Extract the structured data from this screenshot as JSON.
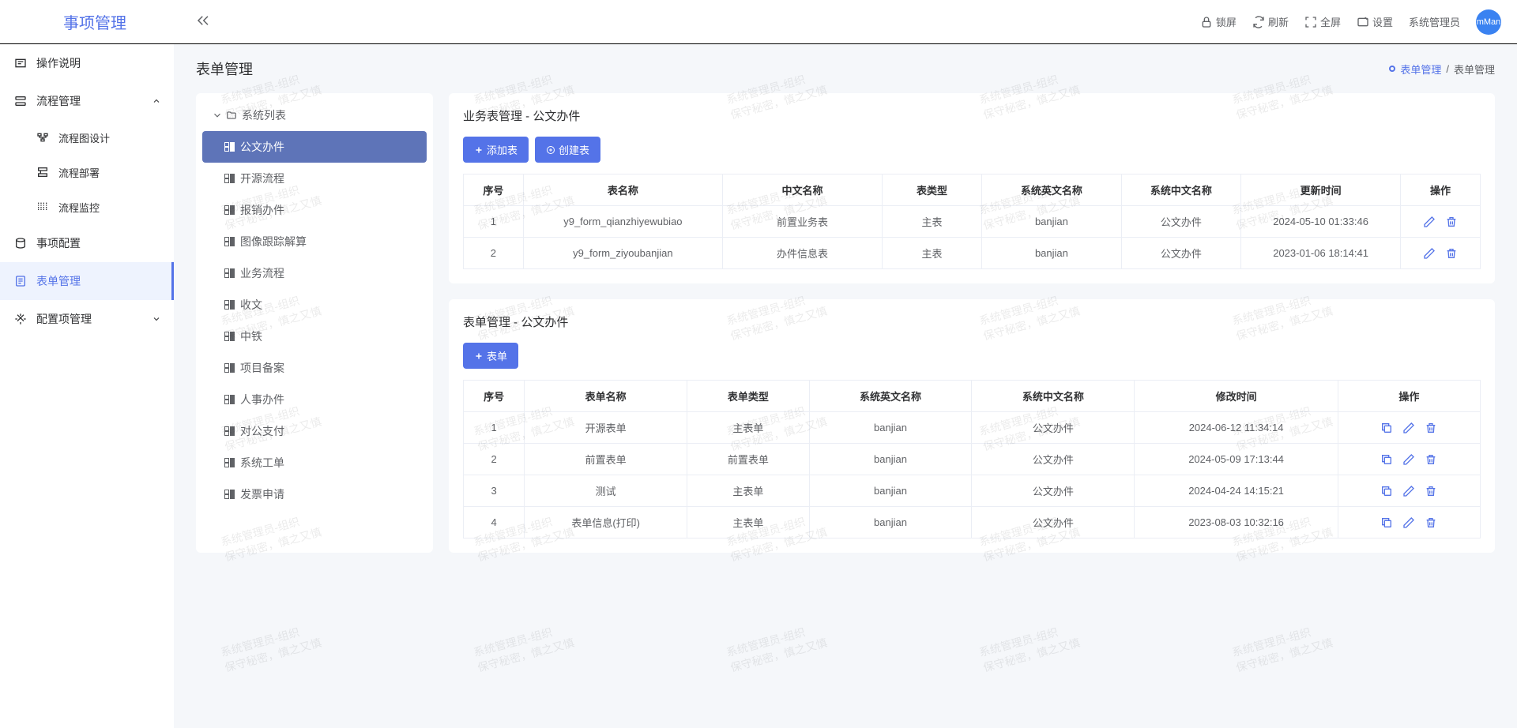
{
  "app_title": "事项管理",
  "header": {
    "lock": "锁屏",
    "refresh": "刷新",
    "fullscreen": "全屏",
    "settings": "设置",
    "username": "系统管理员",
    "avatar_text": "mMan"
  },
  "sidebar": [
    {
      "label": "操作说明",
      "icon": "help",
      "expandable": false,
      "children": []
    },
    {
      "label": "流程管理",
      "icon": "flow",
      "expandable": true,
      "expanded": true,
      "children": [
        {
          "label": "流程图设计",
          "icon": "design"
        },
        {
          "label": "流程部署",
          "icon": "deploy"
        },
        {
          "label": "流程监控",
          "icon": "monitor"
        }
      ]
    },
    {
      "label": "事项配置",
      "icon": "config",
      "expandable": false,
      "children": []
    },
    {
      "label": "表单管理",
      "icon": "form",
      "expandable": false,
      "active": true,
      "children": []
    },
    {
      "label": "配置项管理",
      "icon": "settings",
      "expandable": true,
      "expanded": false,
      "children": []
    }
  ],
  "page": {
    "title": "表单管理",
    "breadcrumb": [
      "表单管理",
      "表单管理"
    ]
  },
  "tree": {
    "root": "系统列表",
    "items": [
      {
        "label": "公文办件",
        "active": true
      },
      {
        "label": "开源流程"
      },
      {
        "label": "报销办件"
      },
      {
        "label": "图像跟踪解算"
      },
      {
        "label": "业务流程"
      },
      {
        "label": "收文"
      },
      {
        "label": "中铁"
      },
      {
        "label": "项目备案"
      },
      {
        "label": "人事办件"
      },
      {
        "label": "对公支付"
      },
      {
        "label": "系统工单"
      },
      {
        "label": "发票申请"
      }
    ]
  },
  "biz_table": {
    "title": "业务表管理 - 公文办件",
    "btn_add": "添加表",
    "btn_create": "创建表",
    "columns": [
      "序号",
      "表名称",
      "中文名称",
      "表类型",
      "系统英文名称",
      "系统中文名称",
      "更新时间",
      "操作"
    ],
    "rows": [
      {
        "idx": "1",
        "name": "y9_form_qianzhiyewubiao",
        "cn": "前置业务表",
        "type": "主表",
        "sys_en": "banjian",
        "sys_cn": "公文办件",
        "time": "2024-05-10 01:33:46"
      },
      {
        "idx": "2",
        "name": "y9_form_ziyoubanjian",
        "cn": "办件信息表",
        "type": "主表",
        "sys_en": "banjian",
        "sys_cn": "公文办件",
        "time": "2023-01-06 18:14:41"
      }
    ]
  },
  "form_table": {
    "title": "表单管理 - 公文办件",
    "btn_add": "表单",
    "columns": [
      "序号",
      "表单名称",
      "表单类型",
      "系统英文名称",
      "系统中文名称",
      "修改时间",
      "操作"
    ],
    "rows": [
      {
        "idx": "1",
        "name": "开源表单",
        "type": "主表单",
        "sys_en": "banjian",
        "sys_cn": "公文办件",
        "time": "2024-06-12 11:34:14"
      },
      {
        "idx": "2",
        "name": "前置表单",
        "type": "前置表单",
        "sys_en": "banjian",
        "sys_cn": "公文办件",
        "time": "2024-05-09 17:13:44"
      },
      {
        "idx": "3",
        "name": "测试",
        "type": "主表单",
        "sys_en": "banjian",
        "sys_cn": "公文办件",
        "time": "2024-04-24 14:15:21"
      },
      {
        "idx": "4",
        "name": "表单信息(打印)",
        "type": "主表单",
        "sys_en": "banjian",
        "sys_cn": "公文办件",
        "time": "2023-08-03 10:32:16"
      }
    ]
  },
  "watermark": "系统管理员-组织\n保守秘密，慎之又慎"
}
